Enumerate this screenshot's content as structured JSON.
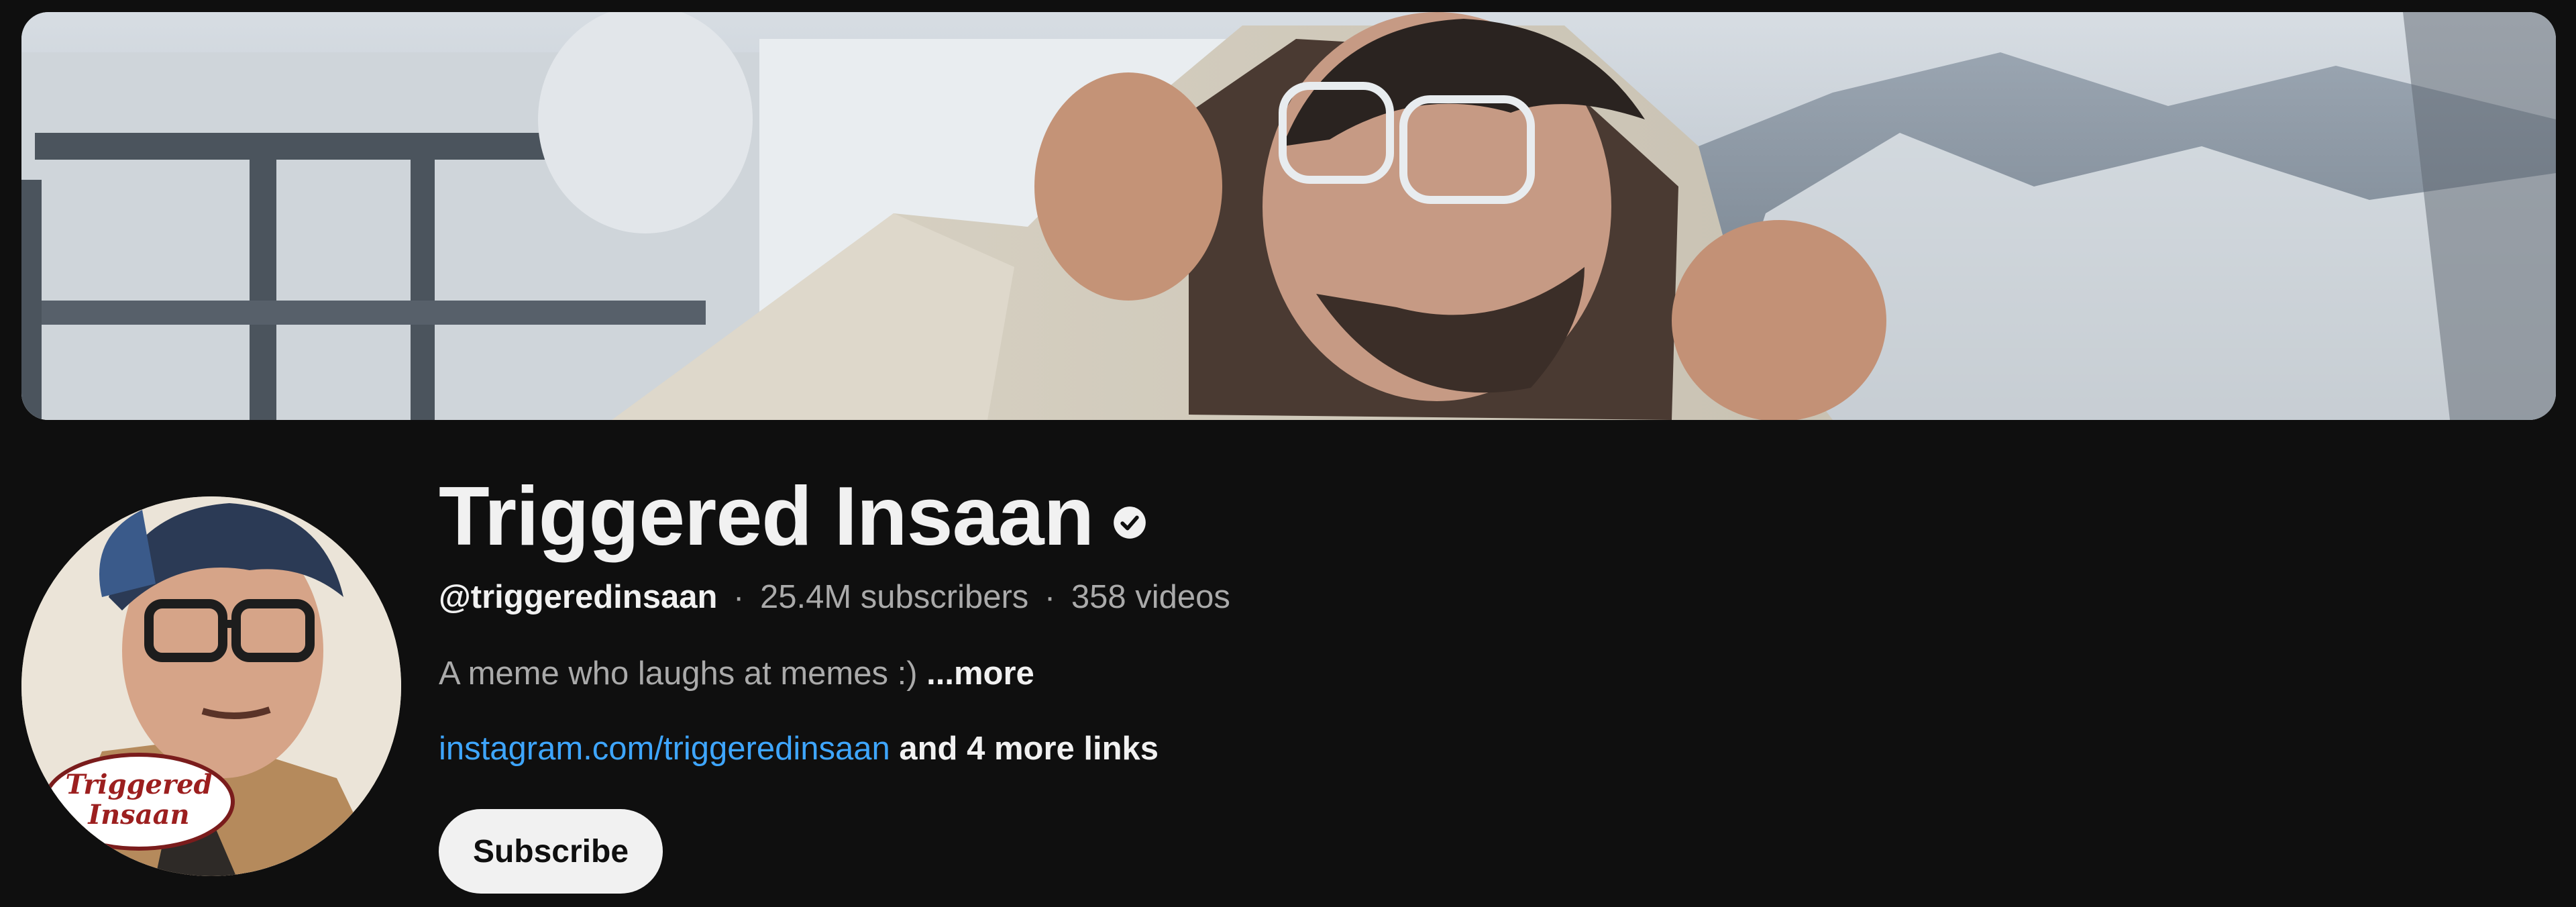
{
  "channel": {
    "name": "Triggered Insaan",
    "verified_icon": "verified-check-icon",
    "handle": "@triggeredinsaan",
    "separator": "·",
    "subscribers": "25.4M subscribers",
    "videos": "358 videos",
    "description": "A meme who laughs at memes :)",
    "description_more": "...more",
    "link_text": "instagram.com/triggeredinsaan",
    "more_links": "and 4 more links",
    "subscribe_label": "Subscribe",
    "avatar_text_line1": "Triggered",
    "avatar_text_line2": "Insaan"
  },
  "colors": {
    "background": "#0f0f0f",
    "text_primary": "#f1f1f1",
    "text_secondary": "#aaaaaa",
    "link": "#3ea6ff",
    "subscribe_bg": "#f1f1f1"
  }
}
